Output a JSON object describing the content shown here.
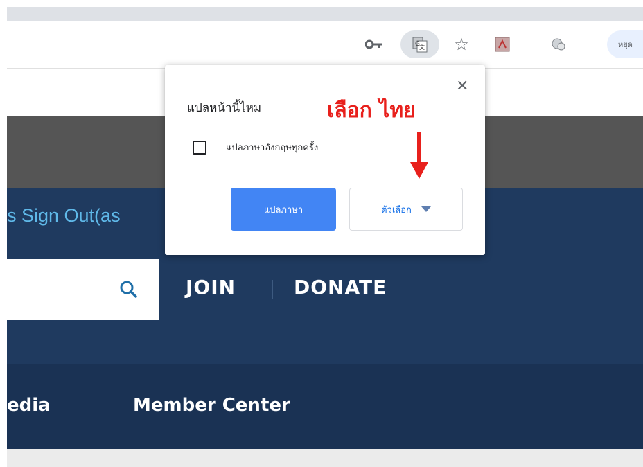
{
  "browser": {
    "profile_button_label": "หยุด",
    "icons": [
      "key-icon",
      "translate-icon",
      "star-icon",
      "pdf-icon",
      "extension-icon"
    ]
  },
  "page": {
    "sign_out_text": "s  Sign Out(as",
    "nav": {
      "join_label": "JOIN",
      "donate_label": "DONATE"
    },
    "menu": {
      "item_media": "edia",
      "item_member_center": "Member Center"
    }
  },
  "translate_popup": {
    "title": "แปลหน้านี้ไหม",
    "always_translate_label": "แปลภาษาอังกฤษทุกครั้ง",
    "always_translate_checked": false,
    "translate_button_label": "แปลภาษา",
    "options_button_label": "ตัวเลือก"
  },
  "annotation": {
    "text": "เลือก ไทย",
    "color": "#e8201c"
  },
  "colors": {
    "navy": "#1f3a5f",
    "link_blue": "#5fb8e8",
    "button_blue": "#4285f4"
  }
}
